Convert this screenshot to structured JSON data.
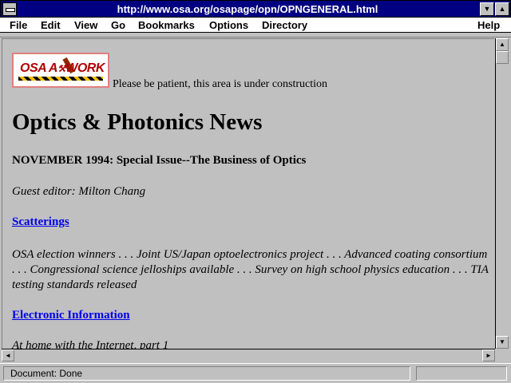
{
  "window": {
    "title": "http://www.osa.org/osapage/opn/OPNGENERAL.html",
    "minimize_glyph": "▼",
    "maximize_glyph": "▲"
  },
  "menubar": {
    "items": [
      {
        "label": "File"
      },
      {
        "label": "Edit"
      },
      {
        "label": "View"
      },
      {
        "label": "Go"
      },
      {
        "label": "Bookmarks"
      },
      {
        "label": "Options"
      },
      {
        "label": "Directory"
      },
      {
        "label": "Help"
      }
    ]
  },
  "page": {
    "logo_text": "OSA AT WORK",
    "patience_note": "Please be patient, this area is under construction",
    "title": "Optics & Photonics News",
    "issue": "NOVEMBER 1994: Special Issue--The Business of Optics",
    "guest_editor": "Guest editor: Milton Chang",
    "sections": [
      {
        "link": "Scatterings",
        "description": "OSA election winners . . . Joint US/Japan optoelectronics project . . . Advanced coating consortium . . . Congressional science jelloships available . . . Survey on high school physics education . . . TIA testing standards released"
      },
      {
        "link": "Electronic Information",
        "description": "At home with the Internet, part 1"
      }
    ]
  },
  "scrollbars": {
    "up_glyph": "▲",
    "down_glyph": "▼",
    "left_glyph": "◄",
    "right_glyph": "►"
  },
  "statusbar": {
    "text": "Document: Done"
  },
  "icons": {
    "system_menu": "system-menu-icon",
    "minimize": "minimize-icon",
    "maximize": "maximize-icon"
  }
}
